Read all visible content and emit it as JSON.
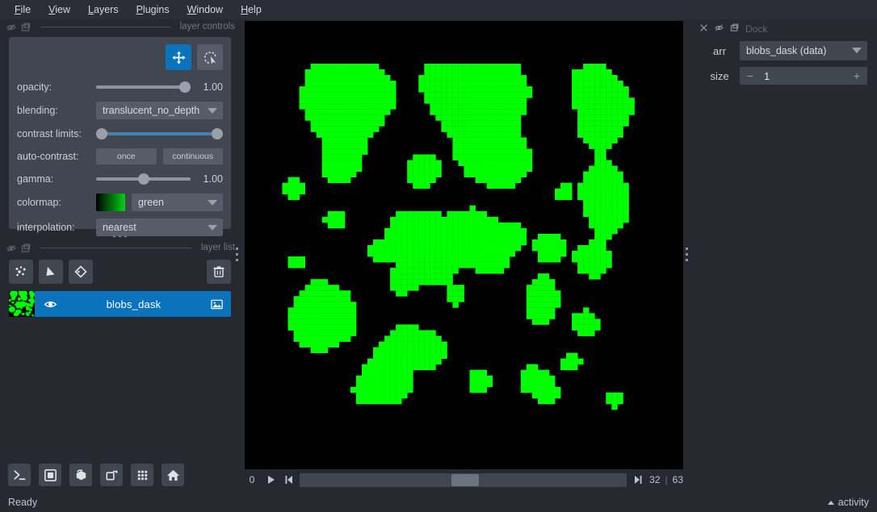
{
  "menubar": {
    "items": [
      {
        "label": "File",
        "accel": "F"
      },
      {
        "label": "View",
        "accel": "V"
      },
      {
        "label": "Layers",
        "accel": "L"
      },
      {
        "label": "Plugins",
        "accel": "P"
      },
      {
        "label": "Window",
        "accel": "W"
      },
      {
        "label": "Help",
        "accel": "H"
      }
    ]
  },
  "layer_controls": {
    "title": "layer controls",
    "modes": [
      {
        "name": "pan-zoom",
        "active": true
      },
      {
        "name": "transform",
        "active": false
      }
    ],
    "opacity": {
      "label": "opacity:",
      "value": "1.00",
      "fraction": 1.0
    },
    "blending": {
      "label": "blending:",
      "value": "translucent_no_depth"
    },
    "contrast_limits": {
      "label": "contrast limits:",
      "low_fraction": 0.0,
      "high_fraction": 1.0
    },
    "auto_contrast": {
      "label": "auto-contrast:",
      "once": "once",
      "continuous": "continuous"
    },
    "gamma": {
      "label": "gamma:",
      "value": "1.00",
      "fraction": 0.5
    },
    "colormap": {
      "label": "colormap:",
      "value": "green",
      "swatch_low": "#000000",
      "swatch_high": "#00d118"
    },
    "interpolation": {
      "label": "interpolation:",
      "value": "nearest"
    }
  },
  "layer_list": {
    "title": "layer list",
    "buttons": [
      {
        "name": "new-points-layer",
        "tooltip": "New points layer"
      },
      {
        "name": "new-shapes-layer",
        "tooltip": "New shapes layer"
      },
      {
        "name": "new-labels-layer",
        "tooltip": "New labels layer"
      },
      {
        "name": "delete-layer",
        "tooltip": "Delete selected layers"
      }
    ],
    "layers": [
      {
        "name": "blobs_dask",
        "selected": true,
        "visible": true,
        "type": "image"
      }
    ]
  },
  "viewer_buttons": [
    {
      "name": "console",
      "tooltip": "Open IPython console"
    },
    {
      "name": "ndisplay-2d",
      "tooltip": "Toggle 2D/3D view"
    },
    {
      "name": "ndisplay-3d",
      "tooltip": "3D view"
    },
    {
      "name": "roll-dimensions",
      "tooltip": "Roll dimensions order"
    },
    {
      "name": "grid-view",
      "tooltip": "Toggle grid view"
    },
    {
      "name": "reset-view",
      "tooltip": "Reset view"
    }
  ],
  "dims_slider": {
    "axis_label": "0",
    "current": "32",
    "separator": "|",
    "max": "63",
    "fraction": 0.508,
    "play_label": "play",
    "first_label": "previous frame",
    "last_label": "next frame"
  },
  "dock": {
    "title": "Dock",
    "fields": [
      {
        "label": "arr",
        "type": "combo",
        "value": "blobs_dask (data)"
      },
      {
        "label": "size",
        "type": "spin",
        "value": "1",
        "minus": "−",
        "plus": "+"
      }
    ]
  },
  "statusbar": {
    "message": "Ready",
    "activity_label": "activity"
  },
  "canvas": {
    "name": "image-canvas",
    "background": "#000000",
    "foreground": "#00ff00",
    "grid_cols": 64,
    "grid_rows": 64,
    "blobs": [
      [
        0.16,
        0.04,
        0.095
      ],
      [
        0.255,
        0.075,
        0.055
      ],
      [
        0.13,
        0.12,
        0.085
      ],
      [
        0.225,
        0.135,
        0.06
      ],
      [
        0.46,
        0.05,
        0.105
      ],
      [
        0.565,
        0.045,
        0.075
      ],
      [
        0.615,
        0.085,
        0.075
      ],
      [
        0.52,
        0.115,
        0.075
      ],
      [
        0.845,
        0.055,
        0.065
      ],
      [
        0.905,
        0.11,
        0.075
      ],
      [
        0.87,
        0.175,
        0.06
      ],
      [
        0.555,
        0.245,
        0.09
      ],
      [
        0.62,
        0.27,
        0.07
      ],
      [
        0.385,
        0.295,
        0.055
      ],
      [
        0.175,
        0.235,
        0.06
      ],
      [
        0.155,
        0.29,
        0.05
      ],
      [
        0.035,
        0.345,
        0.04
      ],
      [
        0.145,
        0.43,
        0.04
      ],
      [
        0.88,
        0.33,
        0.075
      ],
      [
        0.9,
        0.415,
        0.065
      ],
      [
        0.77,
        0.355,
        0.025
      ],
      [
        0.345,
        0.465,
        0.075
      ],
      [
        0.45,
        0.49,
        0.075
      ],
      [
        0.53,
        0.45,
        0.055
      ],
      [
        0.575,
        0.53,
        0.065
      ],
      [
        0.41,
        0.56,
        0.05
      ],
      [
        0.33,
        0.6,
        0.045
      ],
      [
        0.735,
        0.505,
        0.05
      ],
      [
        0.855,
        0.545,
        0.06
      ],
      [
        0.715,
        0.625,
        0.05
      ],
      [
        0.71,
        0.68,
        0.045
      ],
      [
        0.835,
        0.715,
        0.05
      ],
      [
        0.105,
        0.66,
        0.075
      ],
      [
        0.09,
        0.73,
        0.075
      ],
      [
        0.155,
        0.7,
        0.055
      ],
      [
        0.33,
        0.775,
        0.065
      ],
      [
        0.41,
        0.79,
        0.055
      ],
      [
        0.27,
        0.85,
        0.055
      ],
      [
        0.23,
        0.905,
        0.045
      ],
      [
        0.315,
        0.895,
        0.045
      ],
      [
        0.545,
        0.875,
        0.045
      ],
      [
        0.69,
        0.87,
        0.05
      ],
      [
        0.73,
        0.905,
        0.035
      ],
      [
        0.795,
        0.825,
        0.035
      ],
      [
        0.915,
        0.925,
        0.03
      ],
      [
        0.48,
        0.64,
        0.035
      ],
      [
        0.63,
        0.47,
        0.04
      ],
      [
        0.265,
        0.52,
        0.03
      ],
      [
        0.035,
        0.545,
        0.018
      ],
      [
        0.05,
        0.55,
        0.016
      ]
    ]
  }
}
